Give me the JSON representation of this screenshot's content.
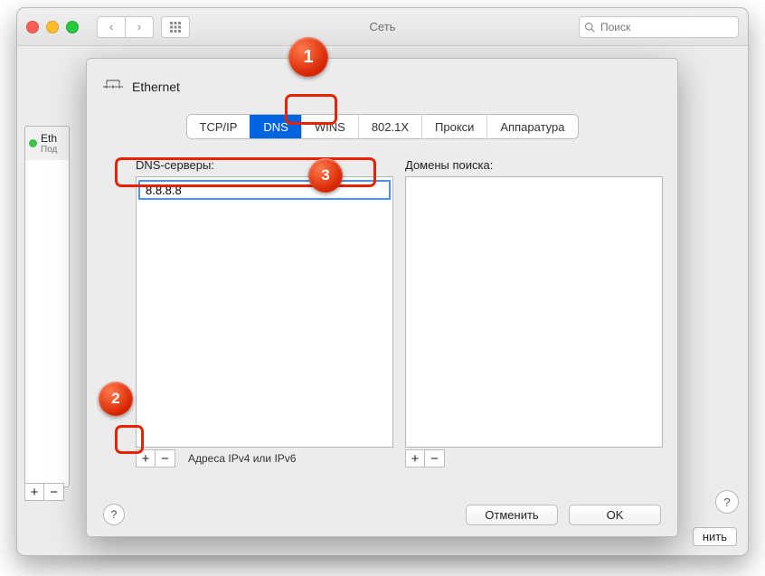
{
  "window_title": "Сеть",
  "search_placeholder": "Поиск",
  "bg_sidebar": {
    "eth_name": "Eth",
    "eth_status": "Под"
  },
  "bg_bottom_button_partial": "нить",
  "sheet": {
    "interface_name": "Ethernet",
    "tabs": {
      "tcpip": "TCP/IP",
      "dns": "DNS",
      "wins": "WINS",
      "x8021": "802.1X",
      "proxy": "Прокси",
      "hardware": "Аппаратура"
    },
    "dns_label": "DNS-серверы:",
    "domains_label": "Домены поиска:",
    "dns_value": "8.8.8.8",
    "hint": "Адреса IPv4 или IPv6",
    "cancel": "Отменить",
    "ok": "OK",
    "help": "?"
  },
  "glyphs": {
    "plus": "+",
    "minus": "−",
    "left": "‹",
    "right": "›",
    "q": "?"
  },
  "callouts": {
    "one": "1",
    "two": "2",
    "three": "3"
  }
}
